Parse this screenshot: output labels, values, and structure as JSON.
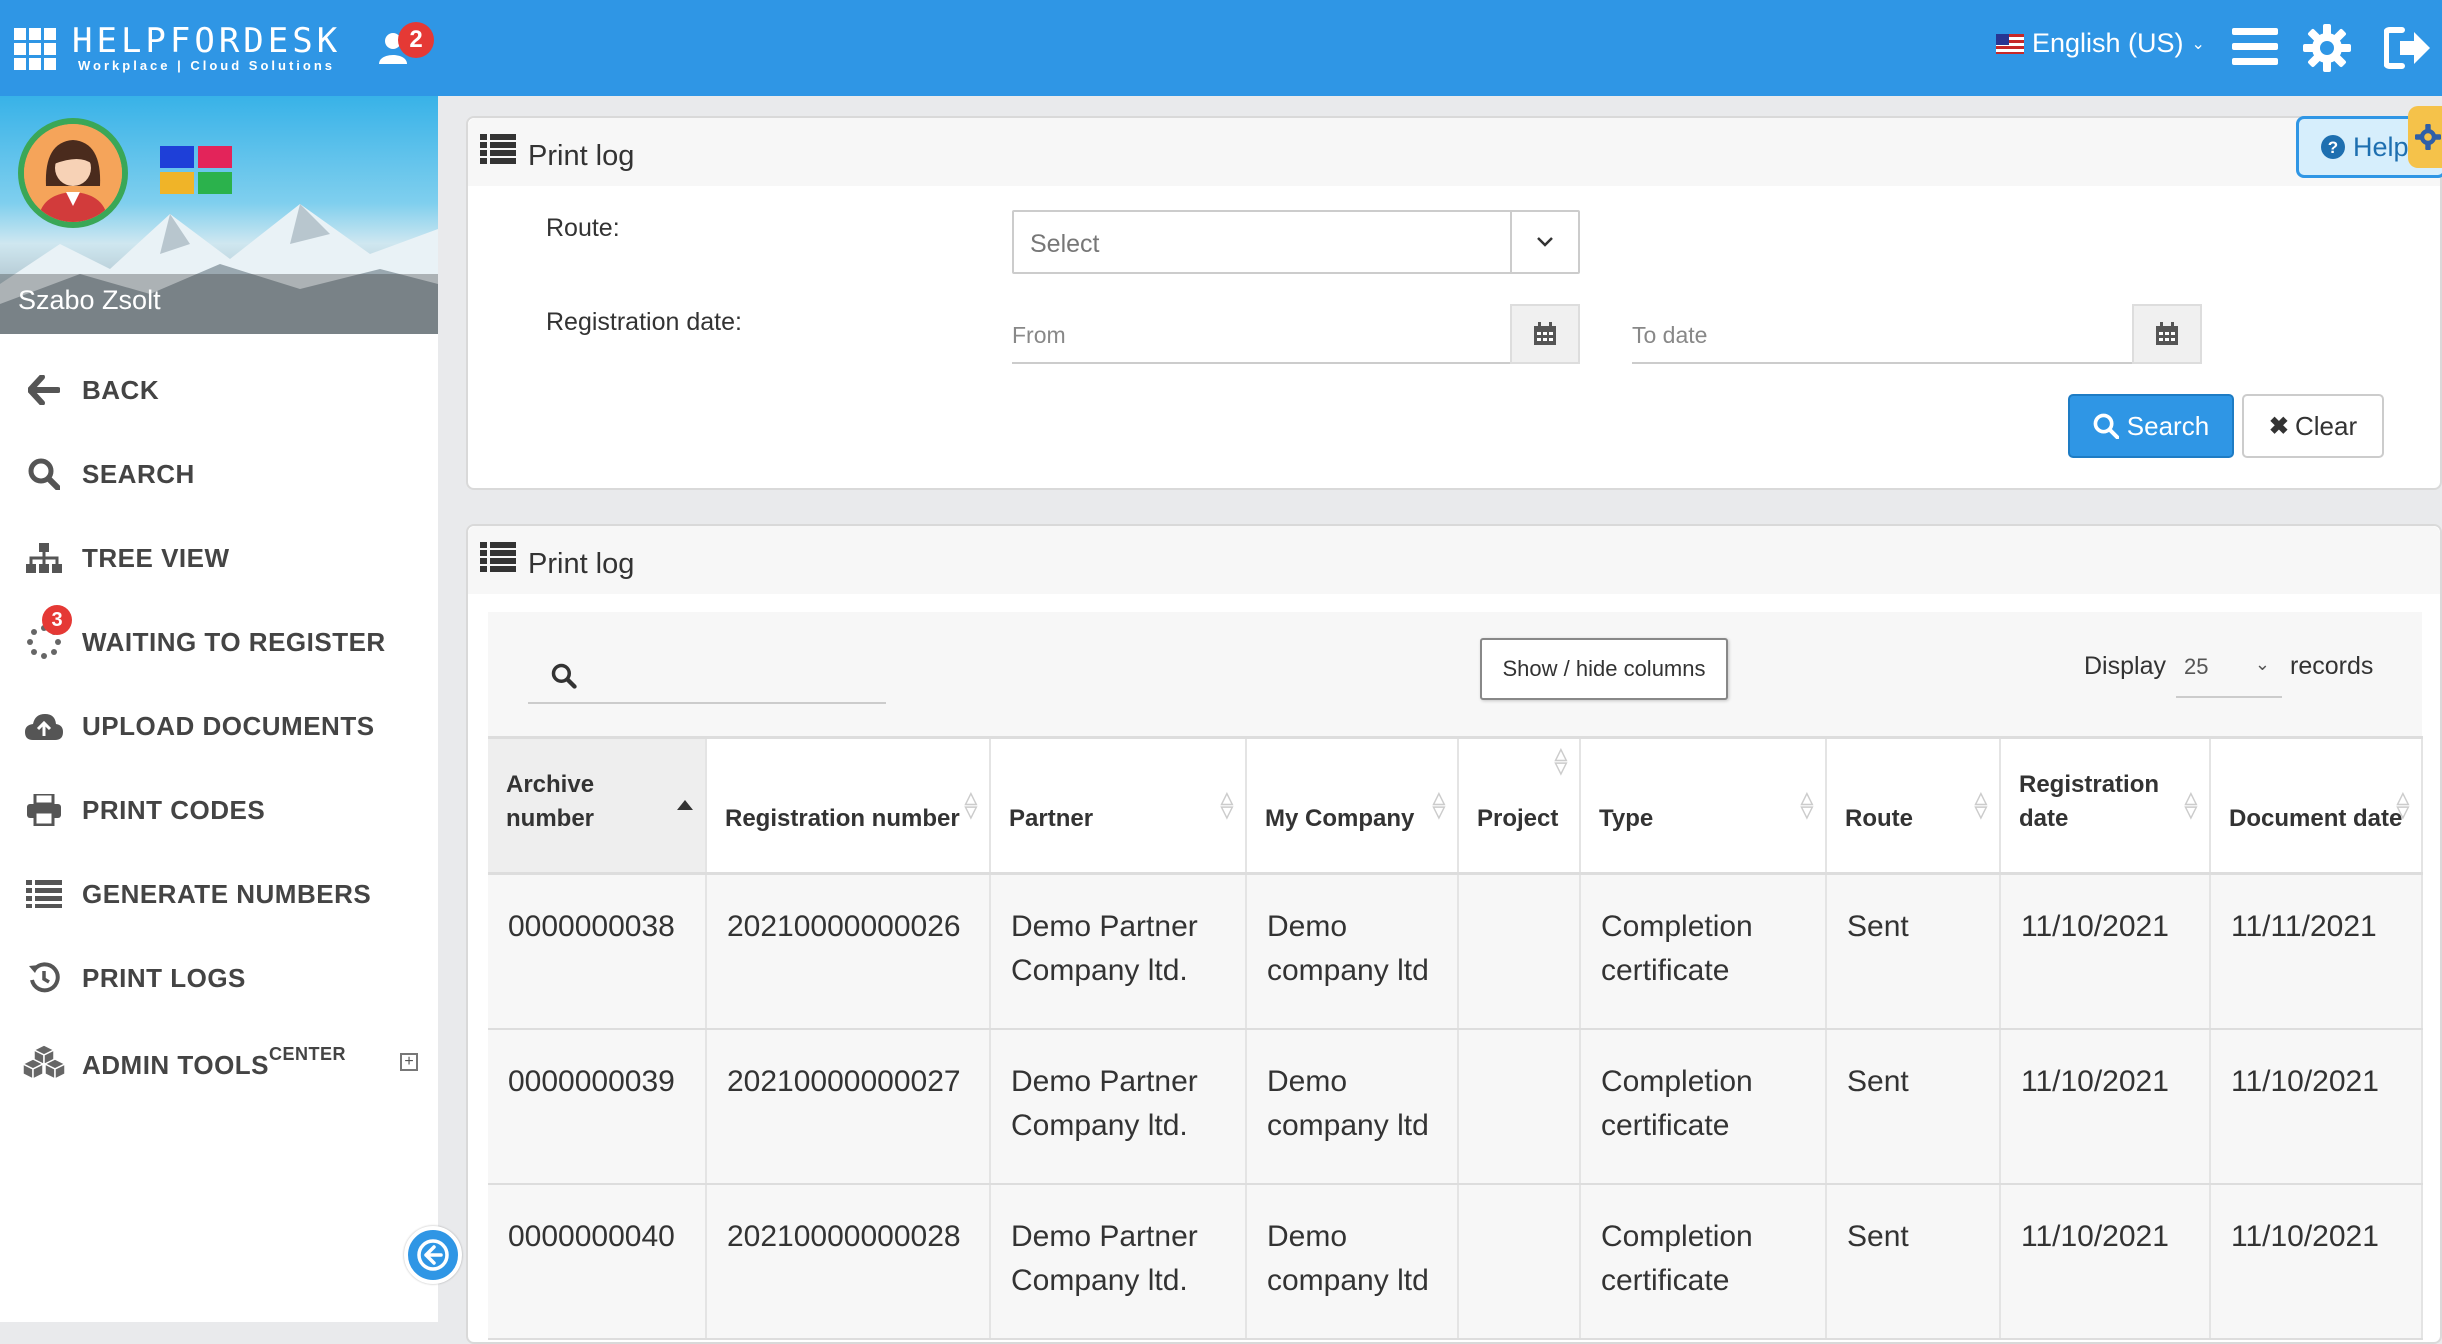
{
  "header": {
    "logo_title": "HELPFORDESK",
    "logo_subtitle": "Workplace | Cloud Solutions",
    "notification_count": "2",
    "language": "English (US)",
    "brand_color": "#2f96e5"
  },
  "sidebar": {
    "user_name": "Szabo Zsolt",
    "items": [
      {
        "label": "BACK",
        "icon": "arrow-left-icon"
      },
      {
        "label": "SEARCH",
        "icon": "search-icon"
      },
      {
        "label": "TREE VIEW",
        "icon": "sitemap-icon"
      },
      {
        "label": "WAITING TO REGISTER",
        "icon": "spinner-icon",
        "badge": "3"
      },
      {
        "label": "UPLOAD DOCUMENTS",
        "icon": "cloud-upload-icon"
      },
      {
        "label": "PRINT CODES",
        "icon": "printer-icon"
      },
      {
        "label": "GENERATE NUMBERS",
        "icon": "list-icon"
      },
      {
        "label": "PRINT LOGS",
        "icon": "history-icon"
      },
      {
        "label": "ADMIN TOOLS",
        "label_sup": "CENTER",
        "icon": "cubes-icon"
      }
    ]
  },
  "filter_panel": {
    "title": "Print log",
    "help_label": "Help",
    "route_label": "Route:",
    "route_placeholder": "Select",
    "registration_date_label": "Registration date:",
    "from_placeholder": "From",
    "to_placeholder": "To date",
    "search_button": "Search",
    "clear_button": "Clear"
  },
  "table_panel": {
    "title": "Print log",
    "show_hide_label": "Show / hide columns",
    "display_label": "Display",
    "display_value": "25",
    "records_label": "records",
    "columns": [
      "Archive number",
      "Registration number",
      "Partner",
      "My Company",
      "Project",
      "Type",
      "Route",
      "Registration date",
      "Document date"
    ],
    "rows": [
      [
        "0000000038",
        "20210000000026",
        "Demo Partner Company ltd.",
        "Demo company ltd",
        "",
        "Completion certificate",
        "Sent",
        "11/10/2021",
        "11/11/2021"
      ],
      [
        "0000000039",
        "20210000000027",
        "Demo Partner Company ltd.",
        "Demo company ltd",
        "",
        "Completion certificate",
        "Sent",
        "11/10/2021",
        "11/10/2021"
      ],
      [
        "0000000040",
        "20210000000028",
        "Demo Partner Company ltd.",
        "Demo company ltd",
        "",
        "Completion certificate",
        "Sent",
        "11/10/2021",
        "11/10/2021"
      ]
    ]
  }
}
